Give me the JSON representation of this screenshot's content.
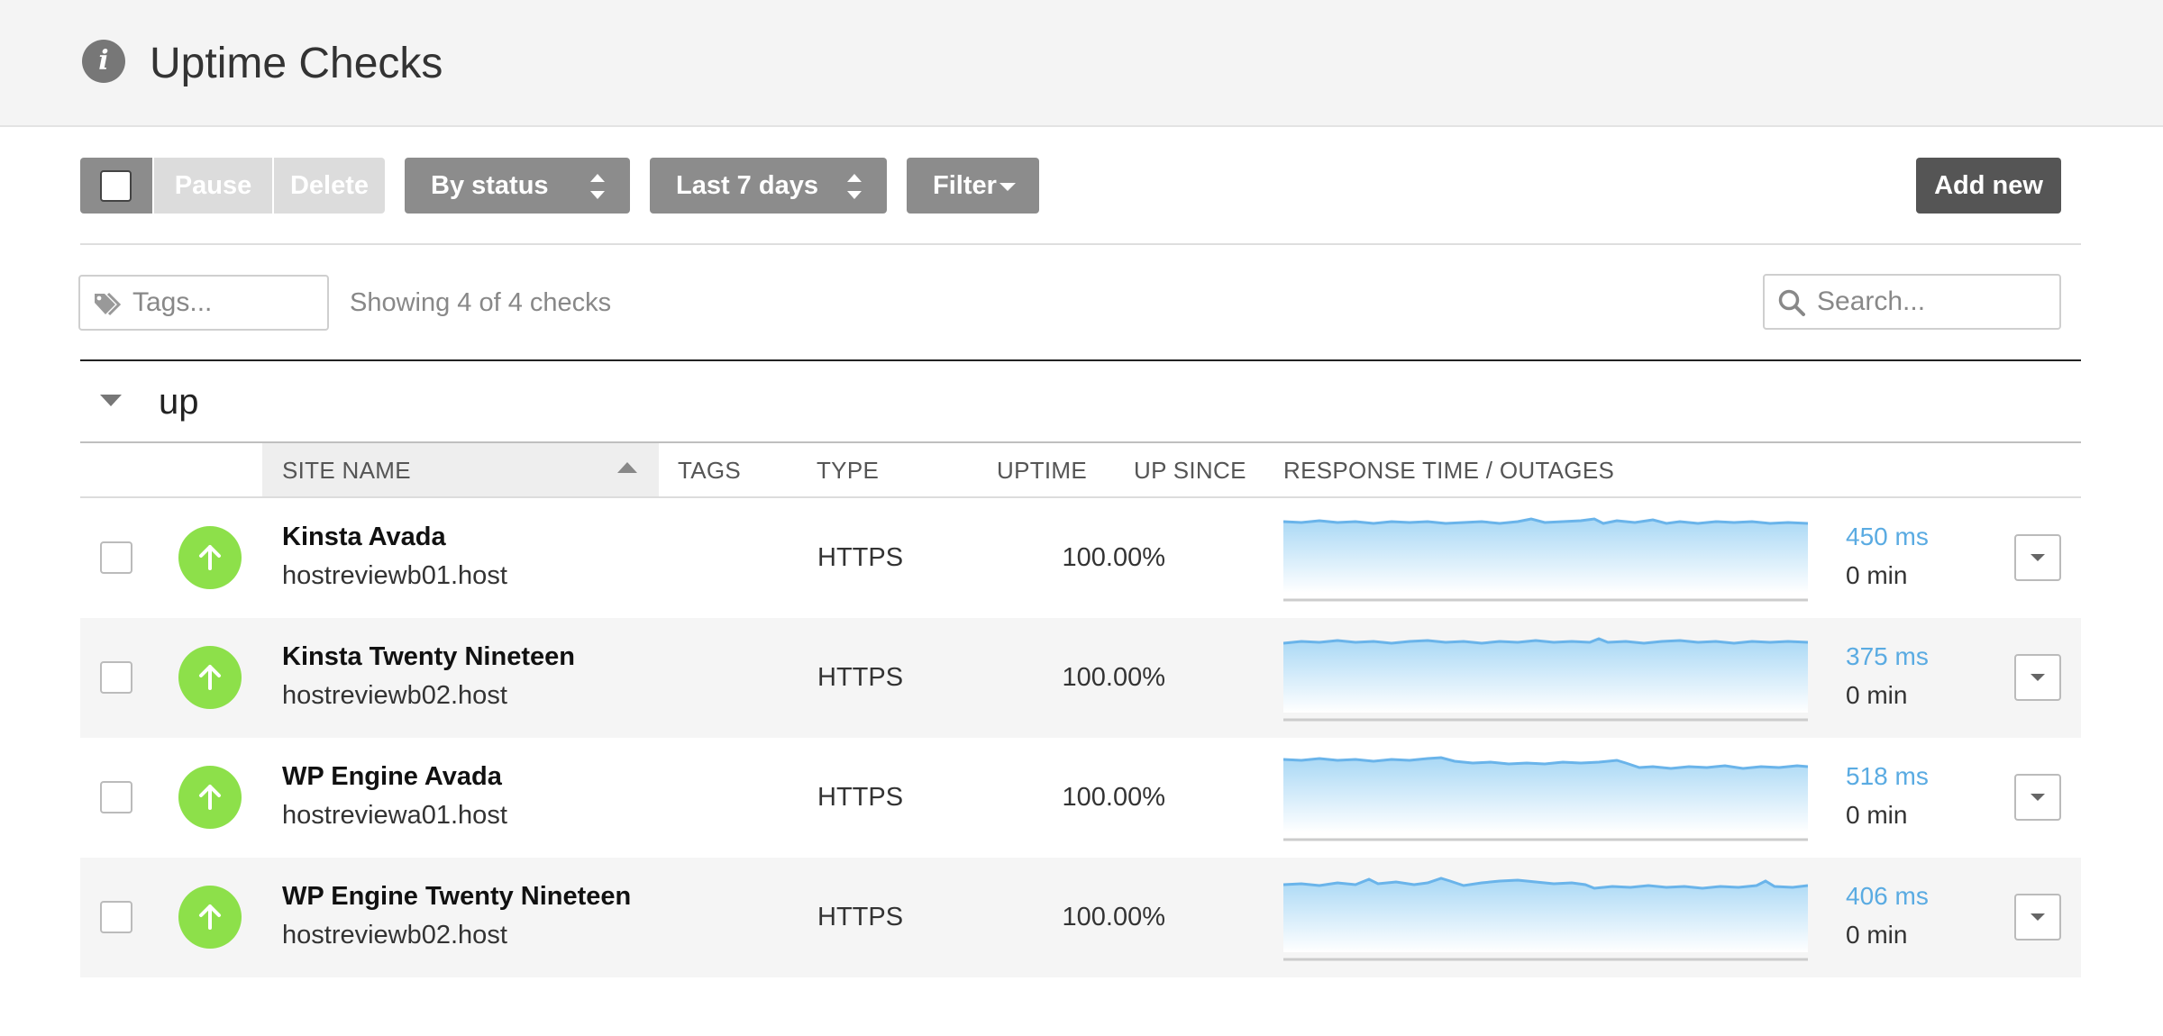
{
  "header": {
    "title": "Uptime Checks",
    "icon": "info-icon"
  },
  "toolbar": {
    "pause_label": "Pause",
    "delete_label": "Delete",
    "sort_label": "By status",
    "range_label": "Last 7 days",
    "filter_label": "Filter",
    "add_label": "Add new"
  },
  "filters": {
    "tags_placeholder": "Tags...",
    "showing_text": "Showing 4 of 4 checks",
    "search_placeholder": "Search..."
  },
  "group": {
    "title": "up"
  },
  "columns": {
    "site_name": "SITE NAME",
    "tags": "TAGS",
    "type": "TYPE",
    "uptime": "UPTIME",
    "up_since": "UP SINCE",
    "response": "RESPONSE TIME / OUTAGES"
  },
  "colors": {
    "up": "#8de04a",
    "accent": "#5aabe2",
    "spark_line": "#6ab4ea"
  },
  "rows": [
    {
      "name": "Kinsta Avada",
      "host": "hostreviewb01.host",
      "type": "HTTPS",
      "uptime": "100.00%",
      "since": "∞",
      "response": "450 ms",
      "outages": "0 min"
    },
    {
      "name": "Kinsta Twenty Nineteen",
      "host": "hostreviewb02.host",
      "type": "HTTPS",
      "uptime": "100.00%",
      "since": "∞",
      "response": "375 ms",
      "outages": "0 min"
    },
    {
      "name": "WP Engine Avada",
      "host": "hostreviewa01.host",
      "type": "HTTPS",
      "uptime": "100.00%",
      "since": "∞",
      "response": "518 ms",
      "outages": "0 min"
    },
    {
      "name": "WP Engine Twenty Nineteen",
      "host": "hostreviewb02.host",
      "type": "HTTPS",
      "uptime": "100.00%",
      "since": "∞",
      "response": "406 ms",
      "outages": "0 min"
    }
  ]
}
